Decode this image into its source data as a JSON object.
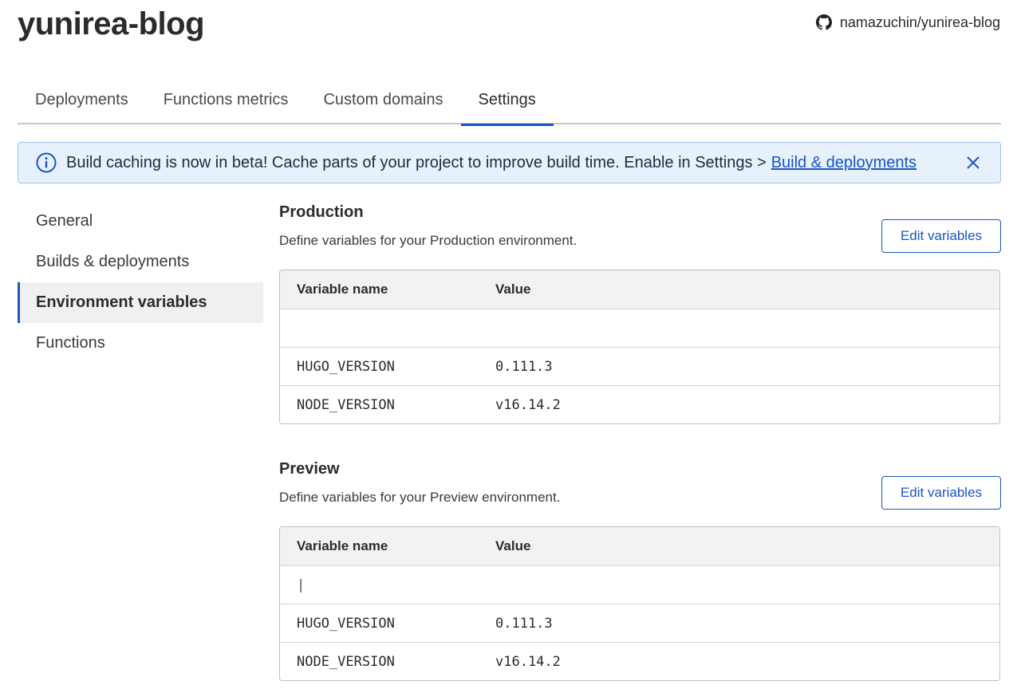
{
  "project": {
    "title": "yunirea-blog"
  },
  "repo": {
    "label": "namazuchin/yunirea-blog",
    "icon": "github-icon"
  },
  "tabs": [
    {
      "label": "Deployments",
      "active": false
    },
    {
      "label": "Functions metrics",
      "active": false
    },
    {
      "label": "Custom domains",
      "active": false
    },
    {
      "label": "Settings",
      "active": true
    }
  ],
  "banner": {
    "icon": "info-icon",
    "message": "Build caching is now in beta! Cache parts of your project to improve build time. Enable in Settings >",
    "link_label": "Build & deployments",
    "close_icon": "close-icon"
  },
  "side_nav": [
    {
      "label": "General",
      "active": false
    },
    {
      "label": "Builds & deployments",
      "active": false
    },
    {
      "label": "Environment variables",
      "active": true
    },
    {
      "label": "Functions",
      "active": false
    }
  ],
  "production": {
    "title": "Production",
    "description": "Define variables for your Production environment.",
    "edit_label": "Edit variables",
    "columns": {
      "name": "Variable name",
      "value": "Value"
    },
    "rows": [
      {
        "name": "",
        "value": ""
      },
      {
        "name": "HUGO_VERSION",
        "value": "0.111.3"
      },
      {
        "name": "NODE_VERSION",
        "value": "v16.14.2"
      }
    ]
  },
  "preview": {
    "title": "Preview",
    "description": "Define variables for your Preview environment.",
    "edit_label": "Edit variables",
    "columns": {
      "name": "Variable name",
      "value": "Value"
    },
    "rows": [
      {
        "name": "|",
        "value": ""
      },
      {
        "name": "HUGO_VERSION",
        "value": "0.111.3"
      },
      {
        "name": "NODE_VERSION",
        "value": "v16.14.2"
      }
    ]
  },
  "colors": {
    "accent": "#1a56c4",
    "banner_bg": "#e6f1fc",
    "banner_border": "#9cc5ef"
  }
}
